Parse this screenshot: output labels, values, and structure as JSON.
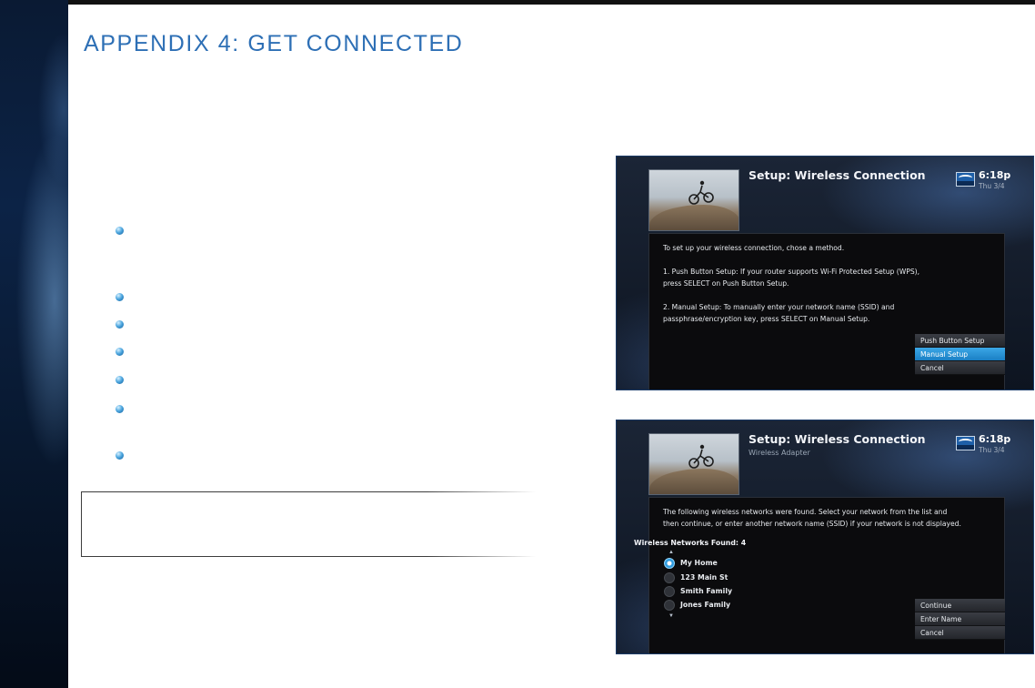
{
  "page": {
    "title": "APPENDIX 4: GET CONNECTED"
  },
  "screens": [
    {
      "title": "Setup: Wireless Connection",
      "subtitle": "",
      "clock": {
        "time": "6:18p",
        "date": "Thu 3/4"
      },
      "lines": [
        "To set up your wireless connection, chose a method.",
        "1. Push Button Setup: If your router supports Wi-Fi Protected Setup (WPS),",
        "press SELECT on Push Button Setup.",
        "2. Manual Setup: To manually enter your network name (SSID) and",
        "passphrase/encryption key, press SELECT on Manual Setup."
      ],
      "menu": [
        "Push Button Setup",
        "Manual Setup",
        "Cancel"
      ],
      "selected_menu": "Manual Setup"
    },
    {
      "title": "Setup: Wireless Connection",
      "subtitle": "Wireless Adapter",
      "clock": {
        "time": "6:18p",
        "date": "Thu 3/4"
      },
      "lines": [
        "The following wireless networks were found. Select your network from the list and",
        "then continue, or enter another network name (SSID) if your network is not displayed."
      ],
      "networks_header": "Wireless Networks Found: 4",
      "networks": [
        "My Home",
        "123 Main St",
        "Smith Family",
        "Jones Family"
      ],
      "selected_network": "My Home",
      "menu": [
        "Continue",
        "Enter Name",
        "Cancel"
      ]
    }
  ],
  "colors": {
    "title_blue": "#2d6fb5",
    "highlight_blue": "#2e9be0",
    "band_navy": "#0c2346"
  }
}
